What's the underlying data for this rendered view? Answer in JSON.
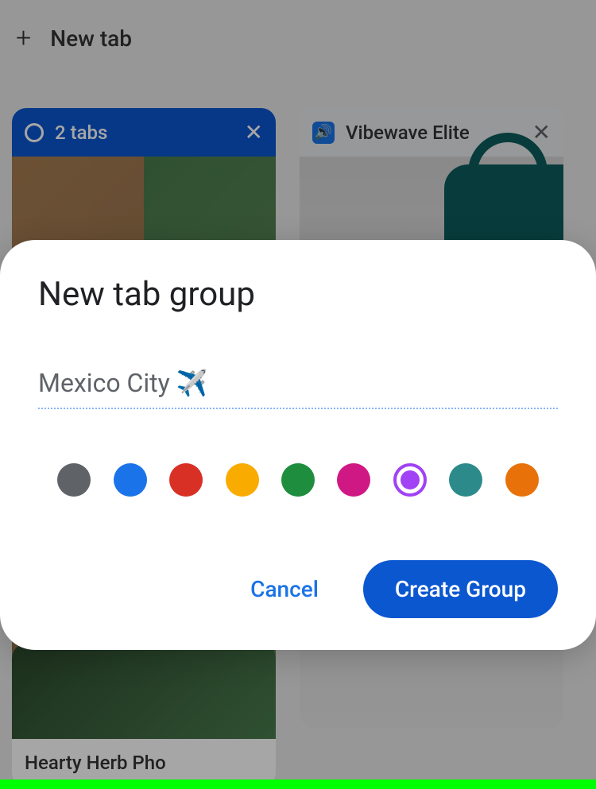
{
  "topbar": {
    "new_tab_label": "New tab"
  },
  "tab_groups": [
    {
      "title": "2 tabs",
      "color": "blue"
    },
    {
      "title": "Vibewave Elite",
      "color": "gray"
    }
  ],
  "bottom_tab": {
    "title": "Hearty Herb Pho"
  },
  "dialog": {
    "title": "New tab group",
    "input_value": "Mexico City ✈️",
    "cancel_label": "Cancel",
    "create_label": "Create Group",
    "colors": [
      {
        "hex": "#5f6368",
        "selected": false
      },
      {
        "hex": "#1a73e8",
        "selected": false
      },
      {
        "hex": "#d93025",
        "selected": false
      },
      {
        "hex": "#f9ab00",
        "selected": false
      },
      {
        "hex": "#1e8e3e",
        "selected": false
      },
      {
        "hex": "#c5221f",
        "selected": false,
        "alt": "#d01884"
      },
      {
        "hex": "#a142f4",
        "selected": true
      },
      {
        "hex": "#2d8a8a",
        "selected": false
      },
      {
        "hex": "#e8710a",
        "selected": false
      }
    ]
  }
}
